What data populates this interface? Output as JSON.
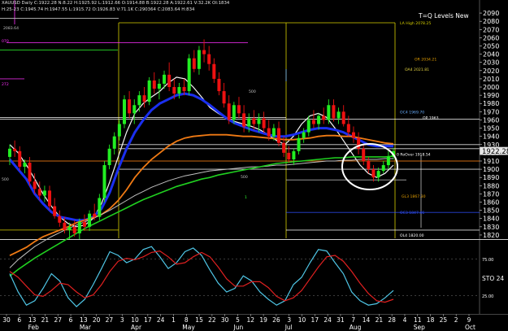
{
  "header": {
    "line1": "XAUUSD Daily  C:1922.28  N:8.22  H:1925.92  L:1912.66  O:1914.88  B:1922.28  A:1922.61  V:32.2K  OI:1834",
    "line2": "H:25-23  C:1945.74  H:1947.55  L:1915.72  O:1926.83  V:71.1K  C:290364  C:2083.64  H:834",
    "level_2083": "2083.64"
  },
  "study_title": "T=Q Levels New",
  "oscillator_label": "STO",
  "oscillator_value": "24",
  "colors": {
    "background": "#000000",
    "price_axis": "#000000",
    "price_axis_text": "#ffffff",
    "candle_up": "#22ee22",
    "candle_down": "#ee1111",
    "ma_blue": "#1a2ff0",
    "ma_orange": "#f07a14",
    "ma_white": "#f4f4f4",
    "ma_grey": "#c0c0c0",
    "ma_green": "#20d020",
    "band_white": "#ffffff",
    "sto_cyan": "#4fc6e6",
    "sto_red": "#e02020",
    "last_price_box": "#e6e6e6"
  },
  "chart_data": [
    {
      "type": "candlestick",
      "y_axis_ticks": [
        2090,
        2080,
        2070,
        2060,
        2050,
        2040,
        2030,
        2020,
        2010,
        2000,
        1990,
        1980,
        1970,
        1960,
        1950,
        1940,
        1930,
        1920,
        1910,
        1900,
        1890,
        1880,
        1870,
        1860,
        1850,
        1840,
        1830,
        1820
      ],
      "ylim": [
        1816,
        2096
      ],
      "last_price": "1922.28",
      "x_tick_labels": [
        "30",
        "6",
        "13",
        "21",
        "27",
        "6",
        "13",
        "20",
        "27",
        "3",
        "10",
        "17",
        "24",
        "1",
        "8",
        "15",
        "22",
        "30",
        "5",
        "12",
        "19",
        "26",
        "3",
        "10",
        "17",
        "24",
        "31",
        "7",
        "14",
        "21",
        "28",
        "4",
        "11",
        "18",
        "25",
        "2",
        "9"
      ],
      "month_labels": [
        "Feb",
        "Mar",
        "Apr",
        "May",
        "Jun",
        "Jul",
        "Aug",
        "Sep",
        "Oct"
      ],
      "candles": [
        [
          1915,
          1930,
          1905,
          1925
        ],
        [
          1925,
          1935,
          1915,
          1922
        ],
        [
          1922,
          1928,
          1898,
          1903
        ],
        [
          1903,
          1912,
          1895,
          1908
        ],
        [
          1908,
          1915,
          1880,
          1885
        ],
        [
          1885,
          1895,
          1870,
          1876
        ],
        [
          1876,
          1885,
          1862,
          1868
        ],
        [
          1868,
          1880,
          1860,
          1874
        ],
        [
          1874,
          1880,
          1850,
          1855
        ],
        [
          1855,
          1865,
          1840,
          1843
        ],
        [
          1843,
          1850,
          1830,
          1835
        ],
        [
          1835,
          1842,
          1822,
          1826
        ],
        [
          1826,
          1835,
          1815,
          1830
        ],
        [
          1830,
          1838,
          1818,
          1822
        ],
        [
          1822,
          1840,
          1815,
          1836
        ],
        [
          1836,
          1845,
          1825,
          1830
        ],
        [
          1830,
          1850,
          1825,
          1846
        ],
        [
          1846,
          1858,
          1838,
          1842
        ],
        [
          1842,
          1870,
          1838,
          1865
        ],
        [
          1865,
          1910,
          1860,
          1905
        ],
        [
          1905,
          1930,
          1900,
          1925
        ],
        [
          1925,
          1945,
          1918,
          1940
        ],
        [
          1940,
          1960,
          1935,
          1955
        ],
        [
          1955,
          1990,
          1950,
          1985
        ],
        [
          1985,
          1995,
          1962,
          1968
        ],
        [
          1968,
          1985,
          1955,
          1978
        ],
        [
          1978,
          1995,
          1970,
          1990
        ],
        [
          1990,
          2000,
          1975,
          1982
        ],
        [
          1982,
          2012,
          1978,
          2008
        ],
        [
          2008,
          2018,
          1992,
          1998
        ],
        [
          1998,
          2010,
          1985,
          2004
        ],
        [
          2004,
          2020,
          1998,
          2015
        ],
        [
          2015,
          2030,
          1995,
          2000
        ],
        [
          2000,
          2010,
          1985,
          1992
        ],
        [
          1992,
          2005,
          1986,
          2000
        ],
        [
          2000,
          2010,
          1990,
          1995
        ],
        [
          1995,
          2040,
          1990,
          2035
        ],
        [
          2035,
          2045,
          2018,
          2022
        ],
        [
          2022,
          2050,
          2015,
          2045
        ],
        [
          2045,
          2058,
          2030,
          2040
        ],
        [
          2040,
          2050,
          2020,
          2028
        ],
        [
          2028,
          2035,
          2005,
          2010
        ],
        [
          2010,
          2018,
          1990,
          1995
        ],
        [
          1995,
          2005,
          1975,
          1980
        ],
        [
          1980,
          1990,
          1955,
          1960
        ],
        [
          1960,
          1982,
          1955,
          1978
        ],
        [
          1978,
          1988,
          1962,
          1968
        ],
        [
          1968,
          1978,
          1945,
          1952
        ],
        [
          1952,
          1968,
          1945,
          1962
        ],
        [
          1962,
          1972,
          1948,
          1955
        ],
        [
          1955,
          1968,
          1945,
          1962
        ],
        [
          1962,
          1970,
          1944,
          1950
        ],
        [
          1950,
          1960,
          1935,
          1940
        ],
        [
          1940,
          1955,
          1935,
          1950
        ],
        [
          1950,
          1958,
          1928,
          1932
        ],
        [
          1932,
          1940,
          1915,
          1920
        ],
        [
          1920,
          1928,
          1908,
          1912
        ],
        [
          1912,
          1925,
          1905,
          1922
        ],
        [
          1922,
          1942,
          1918,
          1938
        ],
        [
          1938,
          1950,
          1932,
          1945
        ],
        [
          1945,
          1965,
          1940,
          1960
        ],
        [
          1960,
          1972,
          1950,
          1955
        ],
        [
          1955,
          1968,
          1948,
          1965
        ],
        [
          1965,
          1975,
          1955,
          1960
        ],
        [
          1960,
          1985,
          1955,
          1978
        ],
        [
          1978,
          1985,
          1958,
          1962
        ],
        [
          1962,
          1975,
          1955,
          1970
        ],
        [
          1970,
          1978,
          1952,
          1955
        ],
        [
          1955,
          1965,
          1940,
          1945
        ],
        [
          1945,
          1952,
          1932,
          1938
        ],
        [
          1938,
          1945,
          1918,
          1925
        ],
        [
          1925,
          1930,
          1905,
          1910
        ],
        [
          1910,
          1915,
          1895,
          1900
        ],
        [
          1900,
          1905,
          1885,
          1890
        ],
        [
          1890,
          1902,
          1885,
          1898
        ],
        [
          1898,
          1910,
          1895,
          1905
        ],
        [
          1905,
          1922,
          1900,
          1915
        ],
        [
          1915,
          1926,
          1912,
          1922
        ]
      ],
      "series": [
        {
          "style": "ma_white",
          "values": [
            1930,
            1920,
            1905,
            1888,
            1870,
            1855,
            1842,
            1834,
            1830,
            1832,
            1840,
            1858,
            1885,
            1915,
            1945,
            1968,
            1980,
            1988,
            1995,
            2005,
            2012,
            2010,
            2000,
            1988,
            1975,
            1968,
            1962,
            1958,
            1955,
            1952,
            1948,
            1942,
            1935,
            1930,
            1940,
            1955,
            1965,
            1968,
            1963,
            1950,
            1935,
            1920,
            1905,
            1895,
            1890,
            1895,
            1905
          ]
        },
        {
          "style": "ma_blue",
          "values": [
            1912,
            1900,
            1888,
            1870,
            1858,
            1848,
            1842,
            1840,
            1838,
            1838,
            1842,
            1852,
            1872,
            1900,
            1925,
            1945,
            1960,
            1972,
            1980,
            1985,
            1990,
            1992,
            1990,
            1985,
            1978,
            1970,
            1962,
            1956,
            1952,
            1948,
            1945,
            1942,
            1940,
            1940,
            1942,
            1945,
            1948,
            1950,
            1950,
            1948,
            1945,
            1940,
            1935,
            1930,
            1928,
            1928,
            1928
          ]
        },
        {
          "style": "ma_orange",
          "values": [
            1795,
            1800,
            1805,
            1812,
            1818,
            1822,
            1826,
            1830,
            1835,
            1838,
            1841,
            1845,
            1852,
            1862,
            1875,
            1890,
            1902,
            1912,
            1920,
            1928,
            1934,
            1938,
            1940,
            1941,
            1942,
            1942,
            1942,
            1941,
            1940,
            1940,
            1939,
            1938,
            1937,
            1936,
            1936,
            1937,
            1938,
            1940,
            1941,
            1941,
            1940,
            1940,
            1938,
            1936,
            1934,
            1932,
            1931
          ]
        },
        {
          "style": "ma_grey",
          "values": [
            1780,
            1790,
            1798,
            1806,
            1812,
            1818,
            1823,
            1828,
            1832,
            1836,
            1840,
            1845,
            1850,
            1856,
            1862,
            1868,
            1873,
            1878,
            1882,
            1886,
            1889,
            1892,
            1894,
            1896,
            1898,
            1899,
            1900,
            1901,
            1902,
            1903,
            1903,
            1904,
            1905,
            1905,
            1906,
            1907,
            1908,
            1909,
            1910,
            1910,
            1911,
            1911,
            1912,
            1912,
            1912,
            1913,
            1913
          ]
        },
        {
          "style": "ma_green",
          "values": [
            1770,
            1778,
            1785,
            1792,
            1798,
            1804,
            1810,
            1816,
            1822,
            1828,
            1833,
            1838,
            1843,
            1848,
            1853,
            1858,
            1863,
            1867,
            1871,
            1875,
            1879,
            1882,
            1885,
            1888,
            1890,
            1893,
            1895,
            1897,
            1899,
            1901,
            1903,
            1905,
            1907,
            1908,
            1909,
            1910,
            1911,
            1912,
            1913,
            1914,
            1914,
            1915,
            1915,
            1915,
            1915,
            1915,
            1916
          ]
        }
      ],
      "horizontal_levels": [
        {
          "value": 2083.64,
          "color": "#c0c0c0"
        },
        {
          "value": 2054,
          "color": "#ff30ff"
        },
        {
          "value": 2045,
          "color": "#30ff30"
        },
        {
          "value": 2010,
          "color": "#ff30ff"
        },
        {
          "value": 1963,
          "color": "#ffffff"
        },
        {
          "value": 1961,
          "color": "#ffffff"
        },
        {
          "value": 1930,
          "color": "#ffffff"
        },
        {
          "value": 1925,
          "color": "#ffffff"
        },
        {
          "value": 1910,
          "color": "#f07a14"
        },
        {
          "value": 1900,
          "color": "#ffffff"
        },
        {
          "value": 1887,
          "color": "#b0b0b0"
        },
        {
          "value": 1847.5,
          "color": "#3050ff"
        },
        {
          "value": 1826,
          "color": "#ffffff"
        }
      ],
      "level_labels": [
        {
          "text": "LA High 2078.25",
          "value": 2078.25,
          "color": "#d8d000"
        },
        {
          "text": "OR 2034.21",
          "value": 2034.21,
          "color": "#e6a000"
        },
        {
          "text": "OA4 2021.81",
          "value": 2021.81,
          "color": "#e0d040"
        },
        {
          "text": "OC4 1969.70",
          "value": 1969.7,
          "color": "#6ab0ff"
        },
        {
          "text": "OP 1963",
          "value": 1963,
          "color": "#ffffff"
        },
        {
          "text": "0 RoOver 1918.54",
          "value": 1918.54,
          "color": "#ffffff"
        },
        {
          "text": "GL3 1867.30",
          "value": 1867.3,
          "color": "#e6a000"
        },
        {
          "text": "OC3 1847.46",
          "value": 1847.46,
          "color": "#3050ff"
        },
        {
          "text": "OL4 1820.00",
          "value": 1820,
          "color": "#ffffff"
        }
      ],
      "side_marks": [
        "070",
        "272",
        "2083.64",
        "500"
      ],
      "chart_marks": [
        "500",
        "500",
        "1"
      ]
    },
    {
      "type": "line",
      "y_tick_labels": [
        "75.00",
        "25.00"
      ],
      "ylim": [
        0,
        100
      ],
      "series": [
        {
          "style": "sto_cyan",
          "values": [
            55,
            30,
            12,
            18,
            35,
            55,
            45,
            22,
            10,
            20,
            40,
            62,
            85,
            80,
            70,
            75,
            88,
            92,
            78,
            62,
            70,
            85,
            90,
            80,
            60,
            42,
            30,
            35,
            52,
            45,
            30,
            20,
            12,
            18,
            40,
            50,
            70,
            88,
            86,
            70,
            55,
            30,
            18,
            12,
            14,
            22,
            32
          ]
        },
        {
          "style": "sto_red",
          "values": [
            58,
            50,
            38,
            26,
            24,
            32,
            42,
            40,
            30,
            22,
            26,
            40,
            58,
            72,
            76,
            74,
            78,
            84,
            86,
            78,
            68,
            70,
            78,
            84,
            78,
            64,
            48,
            38,
            38,
            44,
            44,
            36,
            24,
            18,
            22,
            32,
            48,
            64,
            78,
            80,
            72,
            58,
            42,
            28,
            18,
            16,
            20
          ]
        }
      ]
    }
  ]
}
